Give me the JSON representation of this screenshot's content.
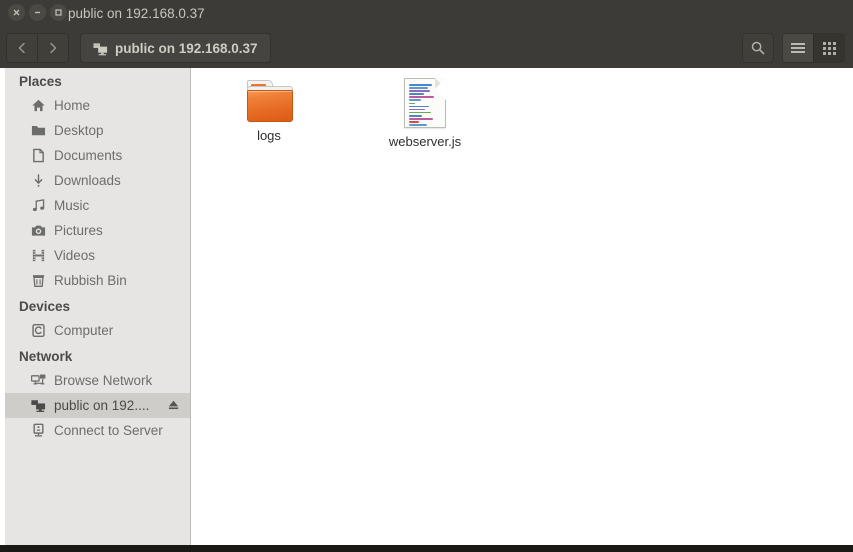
{
  "window": {
    "title": "public on 192.168.0.37",
    "controls": [
      {
        "name": "close",
        "glyph": "×"
      },
      {
        "name": "minimize",
        "glyph": "−"
      },
      {
        "name": "maximize",
        "glyph": "□"
      }
    ]
  },
  "toolbar": {
    "back_icon": "chevron-left-icon",
    "forward_icon": "chevron-right-icon",
    "pathbar": {
      "icon": "network-server-icon",
      "label": "public on 192.168.0.37"
    },
    "search_icon": "search-icon",
    "list_view_icon": "hamburger-menu-icon",
    "grid_view_icon": "grid-view-icon",
    "active_view": "list-view"
  },
  "sidebar": {
    "sections": [
      {
        "header": "Places",
        "items": [
          {
            "label": "Home",
            "icon": "home-icon",
            "selected": false
          },
          {
            "label": "Desktop",
            "icon": "folder-icon",
            "selected": false
          },
          {
            "label": "Documents",
            "icon": "document-icon",
            "selected": false
          },
          {
            "label": "Downloads",
            "icon": "download-icon",
            "selected": false
          },
          {
            "label": "Music",
            "icon": "music-note-icon",
            "selected": false
          },
          {
            "label": "Pictures",
            "icon": "camera-icon",
            "selected": false
          },
          {
            "label": "Videos",
            "icon": "film-strip-icon",
            "selected": false
          },
          {
            "label": "Rubbish Bin",
            "icon": "trash-bin-icon",
            "selected": false
          }
        ]
      },
      {
        "header": "Devices",
        "items": [
          {
            "label": "Computer",
            "icon": "computer-disk-icon",
            "selected": false
          }
        ]
      },
      {
        "header": "Network",
        "items": [
          {
            "label": "Browse Network",
            "icon": "browse-network-icon",
            "selected": false
          },
          {
            "label": "public on 192....",
            "icon": "network-server-icon",
            "selected": true,
            "eject": true
          },
          {
            "label": "Connect to Server",
            "icon": "connect-server-icon",
            "selected": false
          }
        ]
      }
    ]
  },
  "content": {
    "files": [
      {
        "name": "logs",
        "type": "folder"
      },
      {
        "name": "webserver.js",
        "type": "javascript-file"
      }
    ]
  },
  "colors": {
    "titlebar": "#3c3b37",
    "sidebar": "#e6e5e3",
    "selection": "#cecdca",
    "content": "#ffffff",
    "folder_orange": "#e4661f"
  }
}
